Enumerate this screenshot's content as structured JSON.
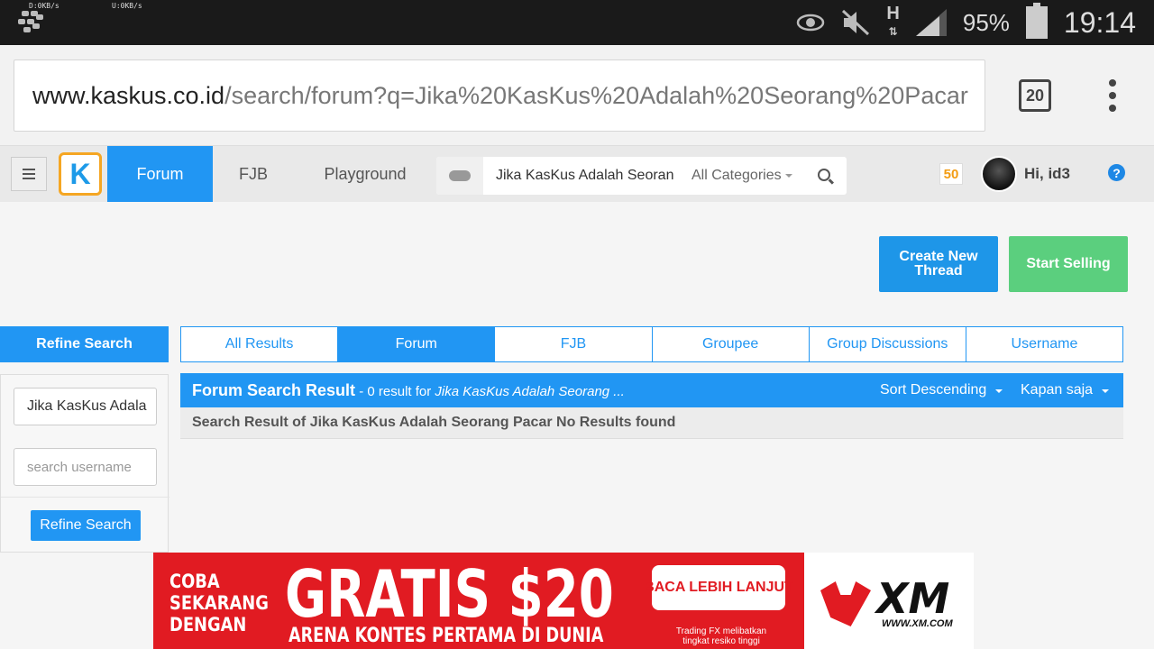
{
  "status_bar": {
    "net_down": "D:0KB/s",
    "net_up": "U:0KB/s",
    "network_type": "H",
    "battery": "95%",
    "time": "19:14"
  },
  "browser": {
    "url_domain": "www.kaskus.co.id",
    "url_path": "/search/forum?q=Jika%20KasKus%20Adalah%20Seorang%20Pacar",
    "tab_count": "20"
  },
  "header": {
    "logo_letter": "K",
    "nav": [
      "Forum",
      "FJB",
      "Playground"
    ],
    "search_query": "Jika KasKus Adalah Seoran",
    "category": "All Categories",
    "notif_count": "50",
    "greeting": "Hi, id3",
    "help": "?"
  },
  "actions": {
    "create_thread": "Create New Thread",
    "start_selling": "Start Selling"
  },
  "refine": {
    "title": "Refine Search",
    "query_value": "Jika KasKus Adala",
    "username_placeholder": "search username",
    "button": "Refine Search"
  },
  "result_tabs": [
    "All Results",
    "Forum",
    "FJB",
    "Groupee",
    "Group Discussions",
    "Username"
  ],
  "results": {
    "title": "Forum Search Result",
    "count_text": " - 0 result for ",
    "query_text": "Jika KasKus Adalah Seorang ...",
    "sort": "Sort Descending",
    "time_filter": "Kapan saja",
    "info": "Search Result of Jika KasKus Adalah Seorang Pacar No Results found"
  },
  "ad": {
    "coba": [
      "COBA",
      "SEKARANG",
      "DENGAN"
    ],
    "headline": "GRATIS $20",
    "subline": "ARENA KONTES PERTAMA DI DUNIA",
    "cta": "BACA LEBIH LANJUT",
    "risk": "Trading FX melibatkan tingkat resiko tinggi",
    "brand": "XM",
    "brand_url": "WWW.XM.COM",
    "brand_color": "#e11b22"
  },
  "colors": {
    "primary": "#2196f3",
    "sell": "#5bcf7e",
    "logo_border": "#f5a623"
  }
}
